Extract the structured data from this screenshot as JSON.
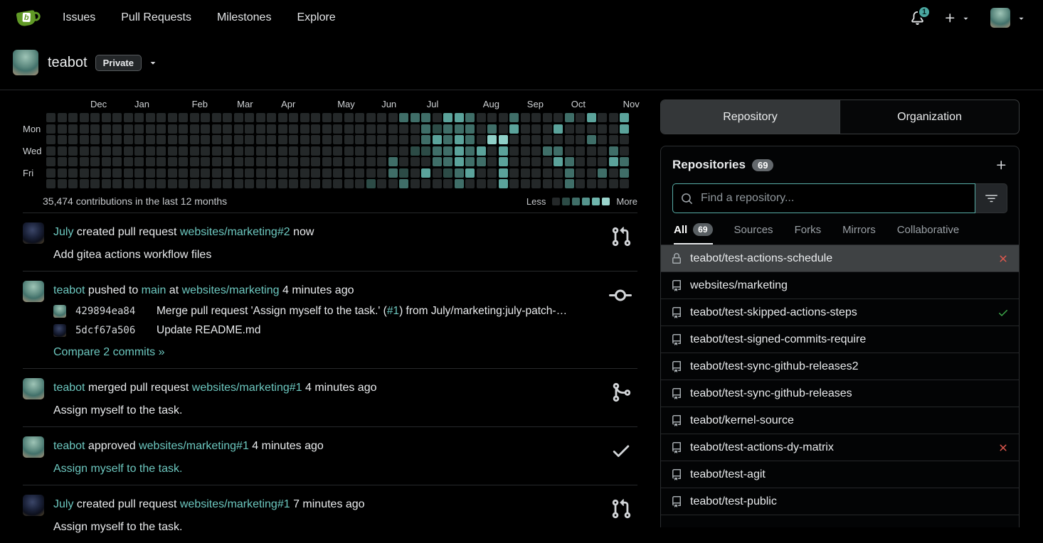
{
  "navbar": {
    "links": [
      "Issues",
      "Pull Requests",
      "Milestones",
      "Explore"
    ],
    "notification_count": "1"
  },
  "header": {
    "org_name": "teabot",
    "visibility_badge": "Private"
  },
  "heatmap": {
    "summary": "35,474 contributions in the last 12 months",
    "less_label": "Less",
    "more_label": "More",
    "months": [
      {
        "label": "Dec",
        "week": 4
      },
      {
        "label": "Jan",
        "week": 8
      },
      {
        "label": "Feb",
        "week": 13.2
      },
      {
        "label": "Mar",
        "week": 17.3
      },
      {
        "label": "Apr",
        "week": 21.3
      },
      {
        "label": "May",
        "week": 26.4
      },
      {
        "label": "Jun",
        "week": 30.4
      },
      {
        "label": "Jul",
        "week": 34.5
      },
      {
        "label": "Aug",
        "week": 39.6
      },
      {
        "label": "Sep",
        "week": 43.6
      },
      {
        "label": "Oct",
        "week": 47.6
      },
      {
        "label": "Nov",
        "week": 52.3
      }
    ],
    "day_labels": [
      {
        "label": "Mon",
        "row": 1
      },
      {
        "label": "Wed",
        "row": 3
      },
      {
        "label": "Fri",
        "row": 5
      }
    ],
    "level_colors": [
      "#242829",
      "#2c4b46",
      "#3f6e68",
      "#5ba39b",
      "#8fd0c8"
    ],
    "legend_colors": [
      "#242829",
      "#2c4b46",
      "#3f6e68",
      "#55948d",
      "#6fb5ad",
      "#9bd5cd"
    ],
    "weeks": [
      "0000000",
      "0000000",
      "0000000",
      "0000000",
      "0000000",
      "0000000",
      "0000000",
      "0000000",
      "0000000",
      "0000000",
      "0000000",
      "0000000",
      "0000000",
      "0000000",
      "0000000",
      "0000000",
      "0000000",
      "0000000",
      "0000000",
      "0000000",
      "0000000",
      "0000000",
      "0000000",
      "0000000",
      "0000000",
      "0000000",
      "0000000",
      "0000000",
      "0000000",
      "0000001",
      "0000000",
      "0000220",
      "2000012",
      "2001000",
      "2221030",
      "0132200",
      "3222210",
      "3233322",
      "2222230",
      "0003200",
      "0240000",
      "0043333",
      "2300000",
      "0000000",
      "0000000",
      "0002000",
      "0302300",
      "2000222",
      "0000000",
      "3020000",
      "0000020",
      "0002300",
      "3300220"
    ]
  },
  "feed": {
    "items": [
      {
        "avatar": "july",
        "icon": "git-pull-request",
        "segments": [
          {
            "t": "July",
            "link": true
          },
          {
            "t": " created pull request ",
            "link": false
          },
          {
            "t": "websites/marketing#2",
            "link": true
          },
          {
            "t": " now",
            "link": false
          }
        ],
        "body": "Add gitea actions workflow files",
        "body_link": false
      },
      {
        "avatar": "teabot",
        "icon": "git-commit",
        "segments": [
          {
            "t": "teabot",
            "link": true
          },
          {
            "t": " pushed to ",
            "link": false
          },
          {
            "t": "main",
            "link": true
          },
          {
            "t": " at ",
            "link": false
          },
          {
            "t": "websites/marketing",
            "link": true
          },
          {
            "t": " 4 minutes ago",
            "link": false
          }
        ],
        "commits": [
          {
            "avatar": "teabot",
            "hash": "429894ea84",
            "message_segments": [
              {
                "t": "Merge pull request 'Assign myself to the task.' (",
                "link": false
              },
              {
                "t": "#1",
                "link": true
              },
              {
                "t": ") from July/marketing:july-patch-…",
                "link": false
              }
            ]
          },
          {
            "avatar": "july",
            "hash": "5dcf67a506",
            "message_segments": [
              {
                "t": "Update README.md",
                "link": false
              }
            ]
          }
        ],
        "compare_label": "Compare 2 commits »"
      },
      {
        "avatar": "teabot",
        "icon": "git-merge",
        "segments": [
          {
            "t": "teabot",
            "link": true
          },
          {
            "t": " merged pull request ",
            "link": false
          },
          {
            "t": "websites/marketing#1",
            "link": true
          },
          {
            "t": " 4 minutes ago",
            "link": false
          }
        ],
        "body": "Assign myself to the task.",
        "body_link": false
      },
      {
        "avatar": "teabot",
        "icon": "check",
        "segments": [
          {
            "t": "teabot",
            "link": true
          },
          {
            "t": " approved ",
            "link": false
          },
          {
            "t": "websites/marketing#1",
            "link": true
          },
          {
            "t": " 4 minutes ago",
            "link": false
          }
        ],
        "body": "Assign myself to the task.",
        "body_link": true
      },
      {
        "avatar": "july",
        "icon": "git-pull-request",
        "segments": [
          {
            "t": "July",
            "link": true
          },
          {
            "t": " created pull request ",
            "link": false
          },
          {
            "t": "websites/marketing#1",
            "link": true
          },
          {
            "t": " 7 minutes ago",
            "link": false
          }
        ],
        "body": "Assign myself to the task.",
        "body_link": false
      }
    ]
  },
  "sidebar": {
    "tabs": [
      {
        "label": "Repository",
        "active": true
      },
      {
        "label": "Organization",
        "active": false
      }
    ],
    "repositories_title": "Repositories",
    "repo_count": "69",
    "search_placeholder": "Find a repository...",
    "filter_tabs": [
      {
        "label": "All",
        "count": "69",
        "active": true
      },
      {
        "label": "Sources",
        "active": false
      },
      {
        "label": "Forks",
        "active": false
      },
      {
        "label": "Mirrors",
        "active": false
      },
      {
        "label": "Collaborative",
        "active": false
      }
    ],
    "repos": [
      {
        "name": "teabot/test-actions-schedule",
        "icon": "lock",
        "status": "fail",
        "hovered": true
      },
      {
        "name": "websites/marketing",
        "icon": "repo",
        "status": null,
        "hovered": false
      },
      {
        "name": "teabot/test-skipped-actions-steps",
        "icon": "repo",
        "status": "success",
        "hovered": false
      },
      {
        "name": "teabot/test-signed-commits-require",
        "icon": "repo",
        "status": null,
        "hovered": false
      },
      {
        "name": "teabot/test-sync-github-releases2",
        "icon": "repo",
        "status": null,
        "hovered": false
      },
      {
        "name": "teabot/test-sync-github-releases",
        "icon": "repo",
        "status": null,
        "hovered": false
      },
      {
        "name": "teabot/kernel-source",
        "icon": "repo",
        "status": null,
        "hovered": false
      },
      {
        "name": "teabot/test-actions-dy-matrix",
        "icon": "repo",
        "status": "fail",
        "hovered": false
      },
      {
        "name": "teabot/test-agit",
        "icon": "repo",
        "status": null,
        "hovered": false
      },
      {
        "name": "teabot/test-public",
        "icon": "repo",
        "status": null,
        "hovered": false
      }
    ]
  }
}
